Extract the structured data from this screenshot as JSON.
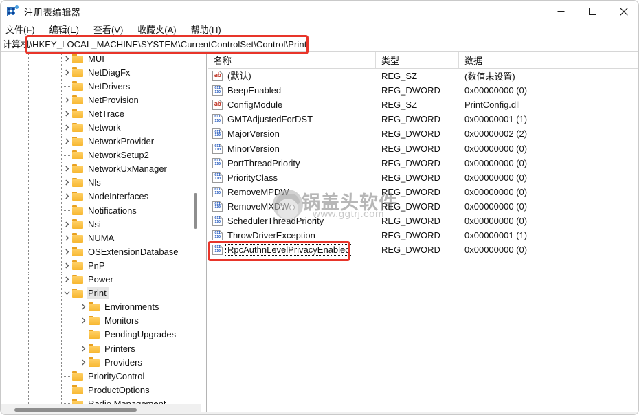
{
  "window": {
    "title": "注册表编辑器",
    "icon": "registry-editor-icon",
    "minimize_label": "—",
    "maximize_label": "□",
    "close_label": "✕"
  },
  "menubar": {
    "items": [
      {
        "label": "文件(F)",
        "name": "menu-file"
      },
      {
        "label": "编辑(E)",
        "name": "menu-edit"
      },
      {
        "label": "查看(V)",
        "name": "menu-view"
      },
      {
        "label": "收藏夹(A)",
        "name": "menu-favorites"
      },
      {
        "label": "帮助(H)",
        "name": "menu-help"
      }
    ]
  },
  "address": {
    "value": "计算机\\HKEY_LOCAL_MACHINE\\SYSTEM\\CurrentControlSet\\Control\\Print",
    "placeholder": "计算机"
  },
  "tree": {
    "nodes": [
      {
        "label": "MUI",
        "indent": 1,
        "expandable": true,
        "expanded": false,
        "selected": false
      },
      {
        "label": "NetDiagFx",
        "indent": 1,
        "expandable": true,
        "expanded": false,
        "selected": false
      },
      {
        "label": "NetDrivers",
        "indent": 1,
        "expandable": false,
        "expanded": false,
        "selected": false
      },
      {
        "label": "NetProvision",
        "indent": 1,
        "expandable": true,
        "expanded": false,
        "selected": false
      },
      {
        "label": "NetTrace",
        "indent": 1,
        "expandable": true,
        "expanded": false,
        "selected": false
      },
      {
        "label": "Network",
        "indent": 1,
        "expandable": true,
        "expanded": false,
        "selected": false
      },
      {
        "label": "NetworkProvider",
        "indent": 1,
        "expandable": true,
        "expanded": false,
        "selected": false
      },
      {
        "label": "NetworkSetup2",
        "indent": 1,
        "expandable": false,
        "expanded": false,
        "selected": false
      },
      {
        "label": "NetworkUxManager",
        "indent": 1,
        "expandable": true,
        "expanded": false,
        "selected": false
      },
      {
        "label": "Nls",
        "indent": 1,
        "expandable": true,
        "expanded": false,
        "selected": false
      },
      {
        "label": "NodeInterfaces",
        "indent": 1,
        "expandable": true,
        "expanded": false,
        "selected": false
      },
      {
        "label": "Notifications",
        "indent": 1,
        "expandable": false,
        "expanded": false,
        "selected": false
      },
      {
        "label": "Nsi",
        "indent": 1,
        "expandable": true,
        "expanded": false,
        "selected": false
      },
      {
        "label": "NUMA",
        "indent": 1,
        "expandable": true,
        "expanded": false,
        "selected": false
      },
      {
        "label": "OSExtensionDatabase",
        "indent": 1,
        "expandable": true,
        "expanded": false,
        "selected": false
      },
      {
        "label": "PnP",
        "indent": 1,
        "expandable": true,
        "expanded": false,
        "selected": false
      },
      {
        "label": "Power",
        "indent": 1,
        "expandable": true,
        "expanded": false,
        "selected": false
      },
      {
        "label": "Print",
        "indent": 1,
        "expandable": true,
        "expanded": true,
        "selected": true
      },
      {
        "label": "Environments",
        "indent": 2,
        "expandable": true,
        "expanded": false,
        "selected": false
      },
      {
        "label": "Monitors",
        "indent": 2,
        "expandable": true,
        "expanded": false,
        "selected": false
      },
      {
        "label": "PendingUpgrades",
        "indent": 2,
        "expandable": false,
        "expanded": false,
        "selected": false
      },
      {
        "label": "Printers",
        "indent": 2,
        "expandable": true,
        "expanded": false,
        "selected": false
      },
      {
        "label": "Providers",
        "indent": 2,
        "expandable": true,
        "expanded": false,
        "selected": false
      },
      {
        "label": "PriorityControl",
        "indent": 1,
        "expandable": false,
        "expanded": false,
        "selected": false
      },
      {
        "label": "ProductOptions",
        "indent": 1,
        "expandable": false,
        "expanded": false,
        "selected": false
      },
      {
        "label": "Radio Management",
        "indent": 1,
        "expandable": false,
        "expanded": false,
        "selected": false
      }
    ]
  },
  "list": {
    "columns": [
      {
        "label": "名称",
        "name": "column-name"
      },
      {
        "label": "类型",
        "name": "column-type"
      },
      {
        "label": "数据",
        "name": "column-data"
      }
    ],
    "rows": [
      {
        "name": "(默认)",
        "type": "REG_SZ",
        "data": "(数值未设置)",
        "icon": "string-value-icon",
        "focused": false
      },
      {
        "name": "BeepEnabled",
        "type": "REG_DWORD",
        "data": "0x00000000 (0)",
        "icon": "dword-value-icon",
        "focused": false
      },
      {
        "name": "ConfigModule",
        "type": "REG_SZ",
        "data": "PrintConfig.dll",
        "icon": "string-value-icon",
        "focused": false
      },
      {
        "name": "GMTAdjustedForDST",
        "type": "REG_DWORD",
        "data": "0x00000001 (1)",
        "icon": "dword-value-icon",
        "focused": false
      },
      {
        "name": "MajorVersion",
        "type": "REG_DWORD",
        "data": "0x00000002 (2)",
        "icon": "dword-value-icon",
        "focused": false
      },
      {
        "name": "MinorVersion",
        "type": "REG_DWORD",
        "data": "0x00000000 (0)",
        "icon": "dword-value-icon",
        "focused": false
      },
      {
        "name": "PortThreadPriority",
        "type": "REG_DWORD",
        "data": "0x00000000 (0)",
        "icon": "dword-value-icon",
        "focused": false
      },
      {
        "name": "PriorityClass",
        "type": "REG_DWORD",
        "data": "0x00000000 (0)",
        "icon": "dword-value-icon",
        "focused": false
      },
      {
        "name": "RemoveMPDW",
        "type": "REG_DWORD",
        "data": "0x00000000 (0)",
        "icon": "dword-value-icon",
        "focused": false
      },
      {
        "name": "RemoveMXDW",
        "type": "REG_DWORD",
        "data": "0x00000000 (0)",
        "icon": "dword-value-icon",
        "focused": false
      },
      {
        "name": "SchedulerThreadPriority",
        "type": "REG_DWORD",
        "data": "0x00000000 (0)",
        "icon": "dword-value-icon",
        "focused": false
      },
      {
        "name": "ThrowDriverException",
        "type": "REG_DWORD",
        "data": "0x00000001 (1)",
        "icon": "dword-value-icon",
        "focused": false
      },
      {
        "name": "RpcAuthnLevelPrivacyEnabled",
        "type": "REG_DWORD",
        "data": "0x00000000 (0)",
        "icon": "dword-value-icon",
        "focused": true
      }
    ]
  },
  "annotations": {
    "accent_color": "#e8352a",
    "address_box_target": "计算机\\HKEY_LOCAL_MACHINE\\SYSTEM\\CurrentControlSet\\Control\\Print",
    "value_box_target": "RpcAuthnLevelPrivacyEnabled"
  },
  "watermark": {
    "text": "锅盖头软件",
    "url": "www.ggtrj.com"
  }
}
